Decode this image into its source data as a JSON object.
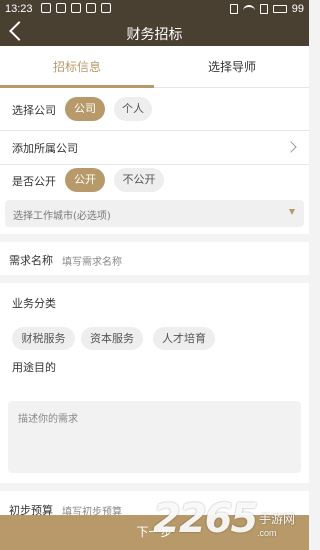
{
  "status_bar": {
    "time": "13:23",
    "battery": "99"
  },
  "header": {
    "title": "财务招标"
  },
  "tabs": [
    {
      "label": "招标信息",
      "active": true
    },
    {
      "label": "选择导师",
      "active": false
    }
  ],
  "company_select": {
    "label": "选择公司",
    "options": [
      "公司",
      "个人"
    ],
    "selected": "公司"
  },
  "affiliated_company": {
    "label": "添加所属公司"
  },
  "public_toggle": {
    "label": "是否公开",
    "options": [
      "公开",
      "不公开"
    ],
    "selected": "公开"
  },
  "city_select": {
    "placeholder": "选择工作城市(必选项)"
  },
  "demand_name": {
    "label": "需求名称",
    "placeholder": "填写需求名称"
  },
  "business_category": {
    "label": "业务分类",
    "options": [
      "财税服务",
      "资本服务",
      "人才培育"
    ]
  },
  "purpose": {
    "label": "用途目的",
    "placeholder": "描述你的需求"
  },
  "budget": {
    "label": "初步预算",
    "placeholder": "填写初步预算"
  },
  "footer": {
    "next_label": "下一步"
  },
  "watermark": {
    "brand": "2265",
    "suffix": ".com",
    "site": "手游网"
  },
  "colors": {
    "header_bg": "#4a4031",
    "accent": "#b89a6a",
    "pill_off": "#eeeeee",
    "page_bg": "#f3f3f3"
  }
}
